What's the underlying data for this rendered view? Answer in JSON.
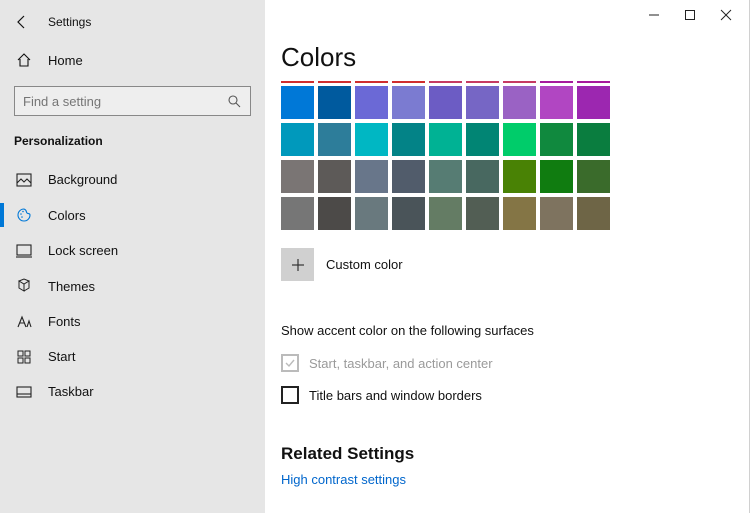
{
  "appTitle": "Settings",
  "home": "Home",
  "searchPlaceholder": "Find a setting",
  "sectionLabel": "Personalization",
  "nav": {
    "background": "Background",
    "colors": "Colors",
    "lockScreen": "Lock screen",
    "themes": "Themes",
    "fonts": "Fonts",
    "start": "Start",
    "taskbar": "Taskbar"
  },
  "pageTitle": "Colors",
  "topLineColors": [
    "#d02e2e",
    "#d02e2e",
    "#d02e2e",
    "#d02e2e",
    "#c63b63",
    "#c63b63",
    "#c63b63",
    "#a61a9d",
    "#a61a9d"
  ],
  "swatchRows": [
    [
      "#0078d7",
      "#005a9e",
      "#6b69d6",
      "#7b7bd1",
      "#6c5cc4",
      "#7666c5",
      "#9a62c4",
      "#b146c2",
      "#9c27b0"
    ],
    [
      "#0099bc",
      "#2d7d9a",
      "#00b7c3",
      "#038387",
      "#00b294",
      "#018574",
      "#00cc6a",
      "#10893e",
      "#0a7d3f"
    ],
    [
      "#7a7574",
      "#5d5a58",
      "#68768a",
      "#515c6b",
      "#567c73",
      "#486860",
      "#498205",
      "#107c10",
      "#3a6b2b"
    ],
    [
      "#767676",
      "#4c4a48",
      "#69797e",
      "#4a5459",
      "#647c64",
      "#525e54",
      "#847545",
      "#7e735f",
      "#6e6546"
    ]
  ],
  "customColor": "Custom color",
  "surfacesHeading": "Show accent color on the following surfaces",
  "checkStartTaskbar": "Start, taskbar, and action center",
  "checkTitleBars": "Title bars and window borders",
  "relatedHeading": "Related Settings",
  "relatedLink": "High contrast settings"
}
